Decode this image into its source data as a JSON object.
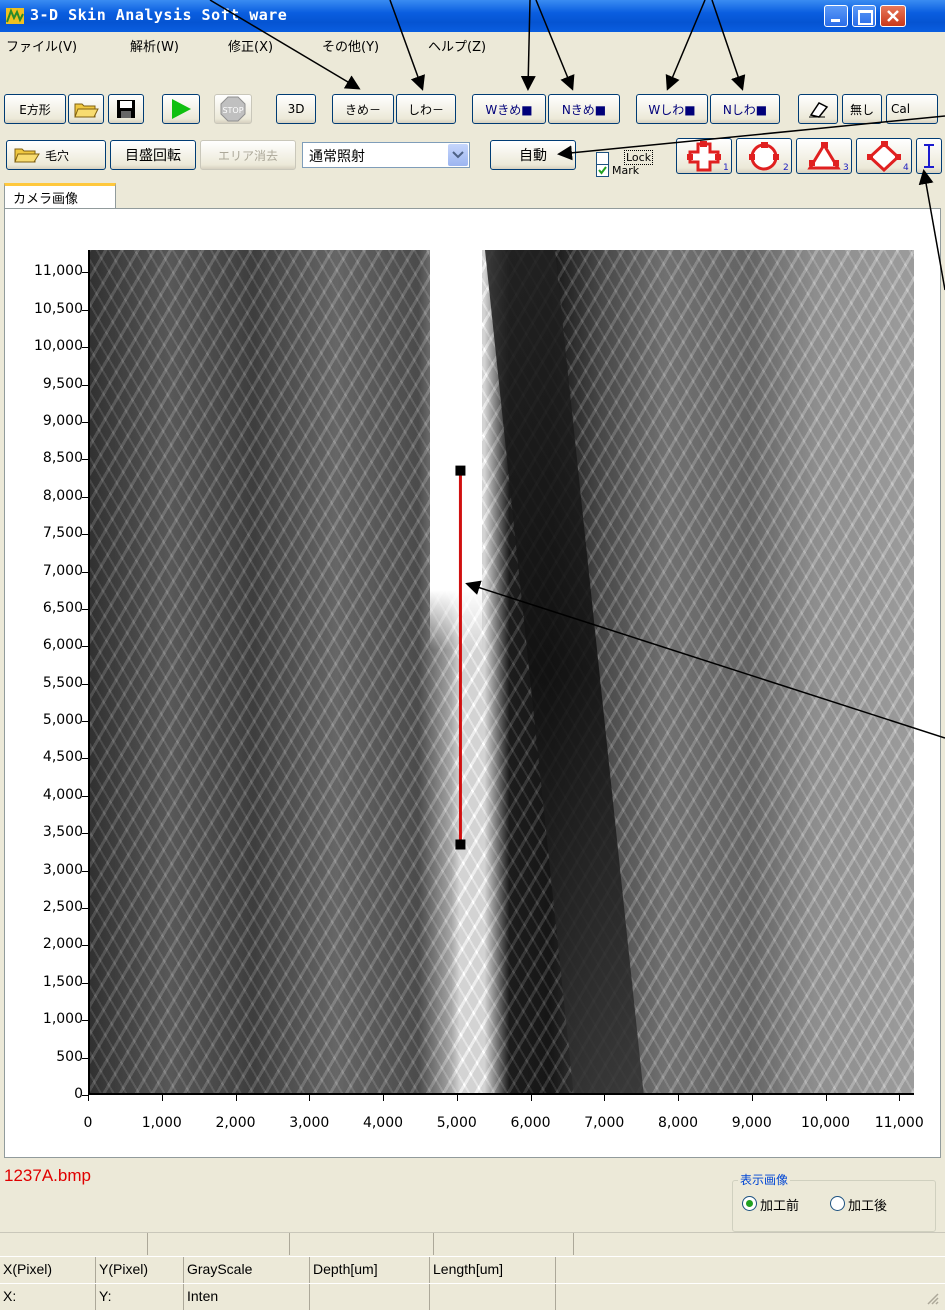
{
  "window": {
    "title": "3-D Skin Analysis Soft ware",
    "colors": {
      "titlebar": "#0a5ee0",
      "accent_red": "#e00000",
      "measure_line": "#d01010",
      "group_title": "#0046d5"
    }
  },
  "menu": {
    "items": [
      "ファイル(V)",
      "解析(W)",
      "修正(X)",
      "その他(Y)",
      "ヘルプ(Z)"
    ]
  },
  "toolbar1": {
    "e_shape": "E方形",
    "open_icon": "folder-open-icon",
    "save_icon": "floppy-save-icon",
    "play_icon": "play-icon",
    "stop_label": "STOP",
    "btn_3d": "3D",
    "kime_minus": "きめ－",
    "shiwa_minus": "しわ－",
    "w_kime": "Wきめ■",
    "n_kime": "Nきめ■",
    "w_shiwa": "Wしわ■",
    "n_shiwa": "Nしわ■",
    "eraser_icon": "eraser-icon",
    "none_label": "無し",
    "cal_label": "Cal"
  },
  "toolbar2": {
    "pore_label": "毛穴",
    "rotate_label": "目盛回転",
    "area_clear_label": "エリア消去",
    "illumination_value": "通常照射",
    "auto_label": "自動",
    "lock_label": "Lock",
    "mark_label": "Mark",
    "mark_checked": true,
    "lock_checked": false,
    "shape_tools": [
      {
        "icon": "cross-shape-icon",
        "num": "1"
      },
      {
        "icon": "circle-shape-icon",
        "num": "2"
      },
      {
        "icon": "triangle-shape-icon",
        "num": "3"
      },
      {
        "icon": "diamond-shape-icon",
        "num": "4"
      }
    ],
    "cursor_tool_icon": "i-beam-cursor-icon"
  },
  "tabs": {
    "camera": "カメラ画像"
  },
  "chart_data": {
    "type": "image-plot",
    "x_ticks": [
      "0",
      "1,000",
      "2,000",
      "3,000",
      "4,000",
      "5,000",
      "6,000",
      "7,000",
      "8,000",
      "9,000",
      "10,000",
      "11,000"
    ],
    "y_ticks": [
      "0",
      "500",
      "1,000",
      "1,500",
      "2,000",
      "2,500",
      "3,000",
      "3,500",
      "4,000",
      "4,500",
      "5,000",
      "5,500",
      "6,000",
      "6,500",
      "7,000",
      "7,500",
      "8,000",
      "8,500",
      "9,000",
      "9,500",
      "10,000",
      "10,500",
      "11,000"
    ],
    "xlim": [
      0,
      11200
    ],
    "ylim": [
      0,
      11300
    ],
    "measure_line": {
      "x": 5050,
      "y_start": 3350,
      "y_end": 8350
    }
  },
  "status": {
    "filename": "1237A.bmp",
    "display_group_title": "表示画像",
    "radio_before": "加工前",
    "radio_after": "加工後",
    "before_selected": true,
    "headers": [
      "X(Pixel)",
      "Y(Pixel)",
      "GrayScale",
      "Depth[um]",
      "Length[um]"
    ],
    "values": [
      "X:",
      "Y:",
      "Inten",
      "",
      ""
    ]
  }
}
